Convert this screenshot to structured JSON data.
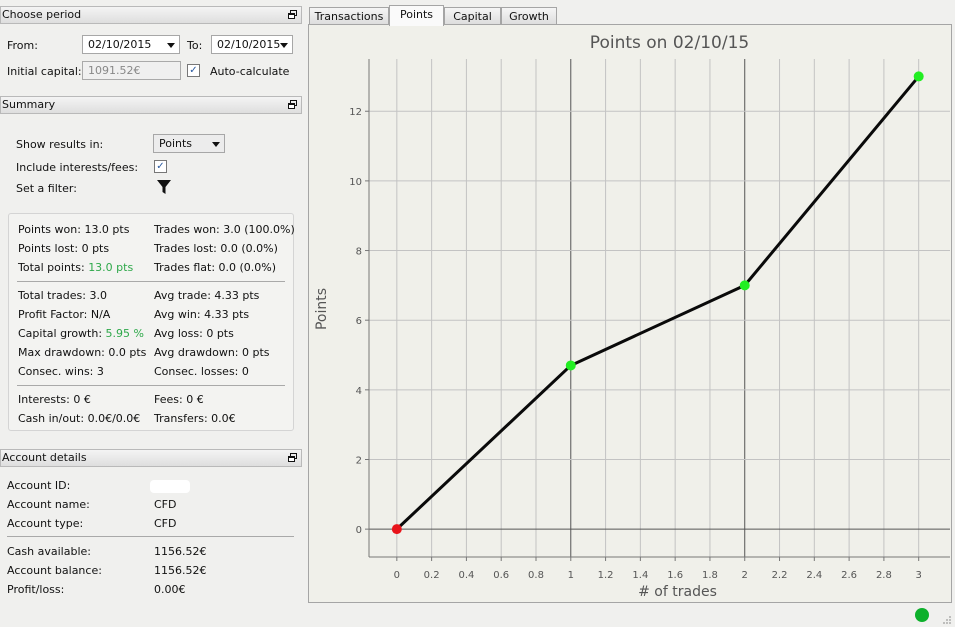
{
  "period": {
    "header": "Choose period",
    "from_label": "From:",
    "from_value": "02/10/2015",
    "to_label": "To:",
    "to_value": "02/10/2015",
    "capital_label": "Initial capital:",
    "capital_value": "1091.52€",
    "auto_label": "Auto-calculate",
    "auto_checked": true
  },
  "summary": {
    "header": "Summary",
    "show_label": "Show results in:",
    "show_value": "Points",
    "include_label": "Include interests/fees:",
    "include_checked": true,
    "filter_label": "Set a filter:",
    "filter_icon": "filter-icon",
    "stats": {
      "points_won": "Points won: 13.0 pts",
      "points_lost": "Points lost: 0 pts",
      "total_points_label": "Total points: ",
      "total_points_value": "13.0 pts",
      "trades_won": "Trades won: 3.0 (100.0%)",
      "trades_lost": "Trades lost: 0.0 (0.0%)",
      "trades_flat": "Trades flat: 0.0 (0.0%)",
      "total_trades": "Total trades: 3.0",
      "profit_factor": "Profit Factor: N/A",
      "capital_growth_label": "Capital growth: ",
      "capital_growth_value": "5.95 %",
      "max_drawdown": "Max drawdown: 0.0 pts",
      "consec_wins": "Consec. wins: 3",
      "avg_trade": "Avg trade: 4.33 pts",
      "avg_win": "Avg win: 4.33 pts",
      "avg_loss": "Avg loss: 0 pts",
      "avg_drawdown": "Avg drawdown: 0 pts",
      "consec_losses": "Consec. losses: 0",
      "interests": "Interests: 0 €",
      "cash_inout": "Cash in/out: 0.0€/0.0€",
      "fees": "Fees: 0 €",
      "transfers": "Transfers: 0.0€"
    }
  },
  "account": {
    "header": "Account details",
    "id_label": "Account ID:",
    "name_label": "Account name:",
    "name_value": "CFD",
    "type_label": "Account type:",
    "type_value": "CFD",
    "cash_label": "Cash available:",
    "cash_value": "1156.52€",
    "balance_label": "Account balance:",
    "balance_value": "1156.52€",
    "pl_label": "Profit/loss:",
    "pl_value": "0.00€"
  },
  "tabs": [
    {
      "label": "Transactions",
      "active": false
    },
    {
      "label": "Points",
      "active": true
    },
    {
      "label": "Capital",
      "active": false
    },
    {
      "label": "Growth",
      "active": false
    }
  ],
  "colors": {
    "positive_green": "#2ea84a",
    "start_point": "#e8141a",
    "point": "#22ee22",
    "status_ok": "#0db02b"
  },
  "chart_data": {
    "type": "line",
    "title": "Points on 02/10/15",
    "xlabel": "# of trades",
    "ylabel": "Points",
    "x": [
      0,
      1,
      2,
      3
    ],
    "values": [
      0,
      4.7,
      7.0,
      13.0
    ],
    "xlim": [
      -0.16,
      3.18
    ],
    "ylim": [
      -0.8,
      13.5
    ],
    "xticks": [
      "0",
      "0.2",
      "0.4",
      "0.6",
      "0.8",
      "1",
      "1.2",
      "1.4",
      "1.6",
      "1.8",
      "2",
      "2.2",
      "2.4",
      "2.6",
      "2.8",
      "3"
    ],
    "yticks": [
      "0",
      "2",
      "4",
      "6",
      "8",
      "10",
      "12"
    ],
    "grid": true
  }
}
